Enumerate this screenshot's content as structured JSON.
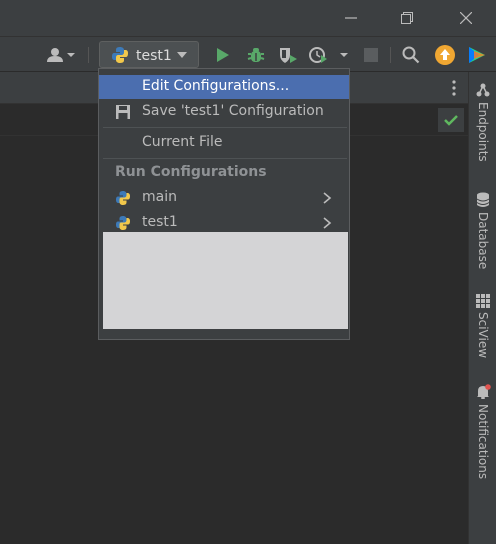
{
  "toolbar": {
    "run_config_label": "test1"
  },
  "menu": {
    "items": [
      {
        "label": "Edit Configurations..."
      },
      {
        "label": "Save 'test1' Configuration"
      },
      {
        "label": "Current File"
      }
    ],
    "section_header": "Run Configurations",
    "configs": [
      {
        "label": "main"
      },
      {
        "label": "test1"
      }
    ]
  },
  "right_sidebar": {
    "tools": [
      {
        "label": "Endpoints",
        "icon": "endpoints-icon"
      },
      {
        "label": "Database",
        "icon": "database-icon"
      },
      {
        "label": "SciView",
        "icon": "sciview-icon"
      },
      {
        "label": "Notifications",
        "icon": "bell-icon"
      }
    ]
  },
  "colors": {
    "selection": "#4b6eaf",
    "run_green": "#59a869",
    "update_orange": "#f0a732",
    "check_green": "#5fb85f"
  }
}
